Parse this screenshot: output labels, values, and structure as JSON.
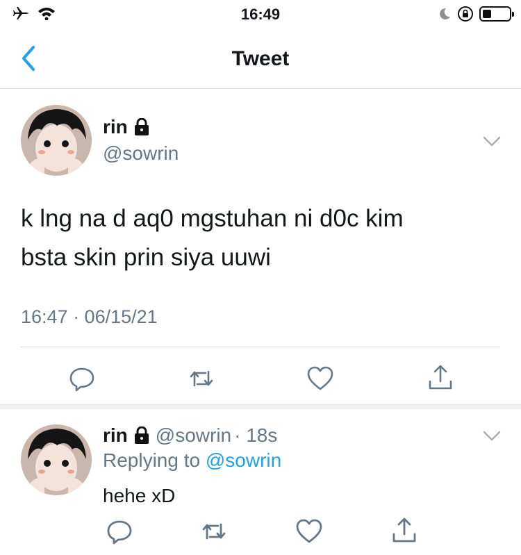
{
  "status_bar": {
    "time": "16:49",
    "icons": [
      "airplane-icon",
      "wifi-icon",
      "moon-icon",
      "orientation-lock-icon",
      "battery-icon"
    ]
  },
  "nav": {
    "title": "Tweet",
    "back_icon": "chevron-left-icon"
  },
  "tweet": {
    "author_name": "rin",
    "author_handle": "@sowrin",
    "protected_icon": "lock-icon",
    "text_line1": "k lng na d aq0 mgstuhan ni d0c kim",
    "text_line2": "bsta skin prin siya uuwi",
    "timestamp": "16:47 · 06/15/21",
    "actions": [
      "reply-icon",
      "retweet-icon",
      "like-icon",
      "share-icon"
    ]
  },
  "reply": {
    "author_name": "rin",
    "author_handle": "@sowrin",
    "time_ago": "· 18s",
    "replying_prefix": "Replying to",
    "replying_mention": "@sowrin",
    "text": "hehe xD",
    "actions": [
      "reply-icon",
      "retweet-icon",
      "like-icon",
      "share-icon"
    ]
  },
  "colors": {
    "accent": "#1da1f2",
    "secondary_text": "#657786",
    "icon": "#657786",
    "divider": "#d6d9db"
  }
}
